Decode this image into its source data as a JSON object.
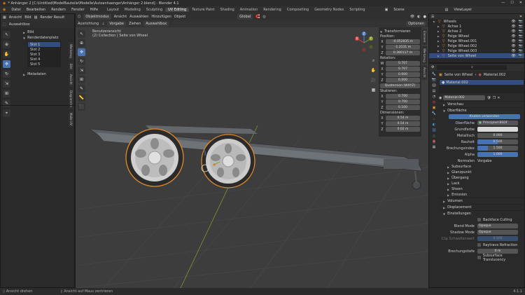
{
  "title": "* Anhänger 2 [C:\\Untitled\\ModelBauteile\\Modelle\\Autoanhaenger\\Anhänger 2.blend] - Blender 4.1",
  "menu": [
    "Datei",
    "Bearbeiten",
    "Rendern",
    "Fenster",
    "Hilfe"
  ],
  "workspaces": [
    "Layout",
    "Modeling",
    "Sculpting",
    "UV Editing",
    "Texture Paint",
    "Shading",
    "Animation",
    "Rendering",
    "Compositing",
    "Geometry Nodes",
    "Scripting"
  ],
  "active_workspace": "UV Editing",
  "scene": {
    "label": "Scene",
    "viewlayer": "ViewLayer"
  },
  "image_editor": {
    "header": {
      "view": "Ansicht",
      "image": "Bild",
      "render_result": "Render Result"
    },
    "tool_label": "Auswahlbox",
    "panel_bild": "Bild",
    "panel_render_slots": "Renderdatenplatz",
    "slots": [
      "Slot 1",
      "Slot 2",
      "Slot 3",
      "Slot 4",
      "Slot 5"
    ],
    "panel_metadata": "Metadaten",
    "tabs": [
      "Werkzeug",
      "Bild",
      "Ansicht",
      "Diagramme",
      "Maße UV"
    ]
  },
  "viewport": {
    "header": {
      "mode": "Objektmodus",
      "view": "Ansicht",
      "select": "Auswählen",
      "add": "Hinzufügen",
      "object": "Objekt",
      "global": "Global"
    },
    "header2": {
      "orientation": "Ausrichtung",
      "default": "Vorgabe",
      "drag": "Ziehen",
      "selectbox": "Auswahlbox",
      "options": "Optionen"
    },
    "overlay_title": "Benutzeransicht",
    "overlay_subtitle": "(2) Collection | Seite von Wheel",
    "gizmo": {
      "x": "X",
      "y": "Y",
      "z": "Z"
    },
    "npanel": {
      "title": "Transformieren",
      "position_label": "Position:",
      "position": [
        {
          "axis": "X",
          "value": "-0.052835 m"
        },
        {
          "axis": "Y",
          "value": "-1.2131 m"
        },
        {
          "axis": "Z",
          "value": "0.380117 m"
        }
      ],
      "rotation_label": "Rotation:",
      "rotation": [
        {
          "axis": "W",
          "value": "0.707"
        },
        {
          "axis": "X",
          "value": "0.707"
        },
        {
          "axis": "Y",
          "value": "0.000"
        },
        {
          "axis": "Z",
          "value": "0.000"
        }
      ],
      "rotation_mode": "Quaternion (WXYZ)",
      "scale_label": "Skalieren:",
      "scale": [
        {
          "axis": "X",
          "value": "0.700"
        },
        {
          "axis": "Y",
          "value": "0.700"
        },
        {
          "axis": "Z",
          "value": "0.100"
        }
      ],
      "dims_label": "Dimensionen:",
      "dims": [
        {
          "axis": "X",
          "value": "0.54 m"
        },
        {
          "axis": "Y",
          "value": "0.54 m"
        },
        {
          "axis": "Z",
          "value": "0.02 m"
        }
      ]
    },
    "tabs": [
      "Element",
      "Werkzeug",
      "Ansicht"
    ]
  },
  "outliner": {
    "search_placeholder": "",
    "items": [
      "Wheels",
      "Achse 1",
      "Achse 2",
      "Felge Wheel",
      "Felge Wheel.001",
      "Felge Wheel.002",
      "Felge Wheel.003",
      "Seite von Wheel"
    ],
    "selected_index": 7
  },
  "properties": {
    "object_name": "Seite von Wheel",
    "material_slot_name": "Material.002",
    "slot_list": [
      "Material.002"
    ],
    "material_field": "Material.002",
    "sections": {
      "preview": "Vorschau",
      "surface": "Oberfläche"
    },
    "use_nodes": "Knoten verwenden",
    "surface_label": "Oberfläche",
    "bsdf": "Principled BSDF",
    "inputs": [
      {
        "label": "Grundfarbe",
        "value": "",
        "color": "#d8d8d8"
      },
      {
        "label": "Metallisch",
        "value": "0.000"
      },
      {
        "label": "Rauheit",
        "value": "0.500",
        "fill": 0.5
      },
      {
        "label": "Brechungsindex",
        "value": "1.500",
        "fill": 0.25
      },
      {
        "label": "Alpha",
        "value": "1.000",
        "fill": 1
      }
    ],
    "normal_label": "Normalen",
    "normal_value": "Vorgabe",
    "subsections": [
      "Subsurface",
      "Glanzpunkt",
      "Übergang",
      "Lack",
      "Sheen",
      "Emission"
    ],
    "volume": "Volumen",
    "displacement": "Displacement",
    "settings": "Einstellungen",
    "backface": "Backface Culling",
    "blend_label": "Blend Mode",
    "blend_value": "Opaque",
    "shadow_label": "Shadow Mode",
    "shadow_value": "Opaque",
    "clip_label": "Clip Schwellenwert",
    "clip_value": "0.500",
    "raytrace": "Raytrace Refraction",
    "refr_label": "Brechungstiefe",
    "refr_value": "0 m",
    "subsurface_tr": "Subsurface Translucency"
  },
  "status": {
    "left": "Ansicht drehen",
    "mid": "Ansicht auf Maus zentrieren",
    "version": "4.1.1"
  }
}
